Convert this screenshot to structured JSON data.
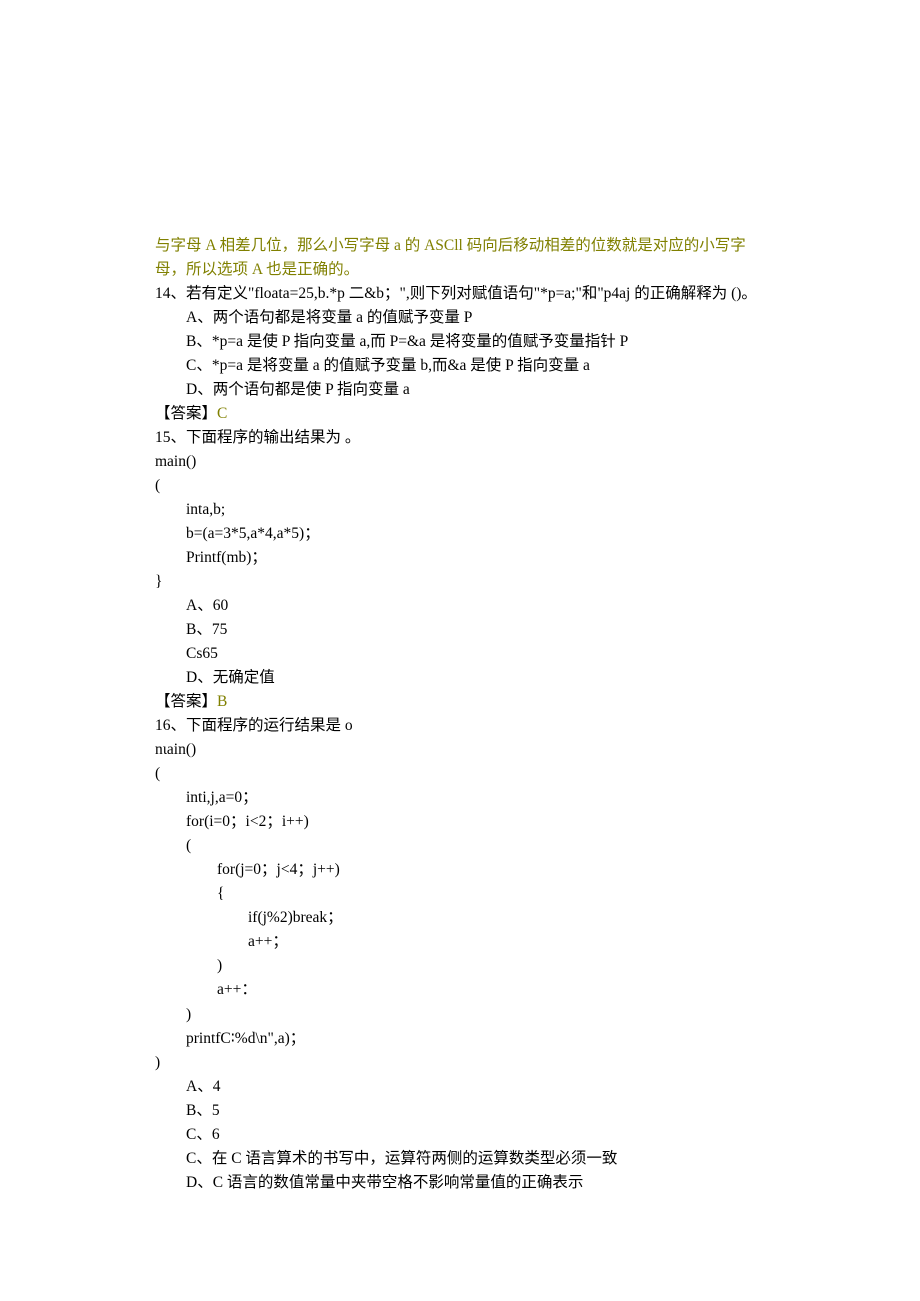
{
  "intro": "与字母 A 相差几位，那么小写字母 a 的 ASCll 码向后移动相差的位数就是对应的小写字母，所以选项 A 也是正确的。",
  "q14": {
    "stem": "14、若有定义\"floata=25,b.*p 二&b；\",则下列对赋值语句\"*p=a;\"和\"p4aj 的正确解释为 ()。",
    "a": "A、两个语句都是将变量 a 的值赋予变量 P",
    "b": "B、*p=a 是使 P 指向变量 a,而 P=&a 是将变量的值赋予变量指针 P",
    "c": "C、*p=a 是将变量 a 的值赋予变量 b,而&a 是使 P 指向变量 a",
    "d": "D、两个语句都是使 P 指向变量 a",
    "ans_label": "【答案】",
    "ans_val": "C"
  },
  "q15": {
    "stem": "15、下面程序的输出结果为 。",
    "c1": "main()",
    "c2": "(",
    "c3": "inta,b;",
    "c4": "b=(a=3*5,a*4,a*5)；",
    "c5": "Printf(mb)；",
    "c6": "}",
    "a": "A、60",
    "b": "B、75",
    "c": "Cs65",
    "d": "D、无确定值",
    "ans_label": "【答案】",
    "ans_val": "B"
  },
  "q16": {
    "stem": "16、下面程序的运行结果是 o",
    "c01": "nιain()",
    "c02": "(",
    "c03": "inti,j,a=0；",
    "c04": "for(i=0；i<2；i++)",
    "c05": "(",
    "c06": "for(j=0；j<4；j++)",
    "c07": "{",
    "c08": "if(j%2)break；",
    "c09": "a++；",
    "c10": ")",
    "c11": "a++：",
    "c12": ")",
    "c13": "printfC∶%d\\n\",a)；",
    "c14": ")",
    "a": "A、4",
    "b": "B、5",
    "c": "C、6",
    "d": "C、在 C 语言算术的书写中，运算符两侧的运算数类型必须一致",
    "e": "D、C 语言的数值常量中夹带空格不影响常量值的正确表示"
  }
}
